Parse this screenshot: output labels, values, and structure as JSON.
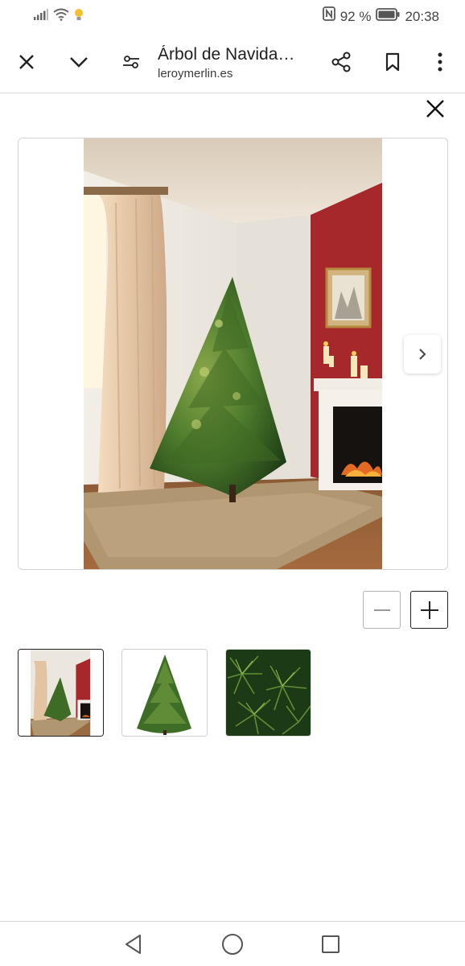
{
  "status_bar": {
    "battery": "92 %",
    "time": "20:38"
  },
  "toolbar": {
    "title": "Árbol de Navida…",
    "url": "leroymerlin.es"
  },
  "colors": {
    "wall_red": "#a6282a",
    "tree_green": "#2f5a1f",
    "rug": "#b19672"
  },
  "gallery": {
    "thumbnails": [
      "room-tree-thumbnail",
      "tree-white-bg-thumbnail",
      "needles-closeup-thumbnail"
    ],
    "selected_index": 0
  }
}
